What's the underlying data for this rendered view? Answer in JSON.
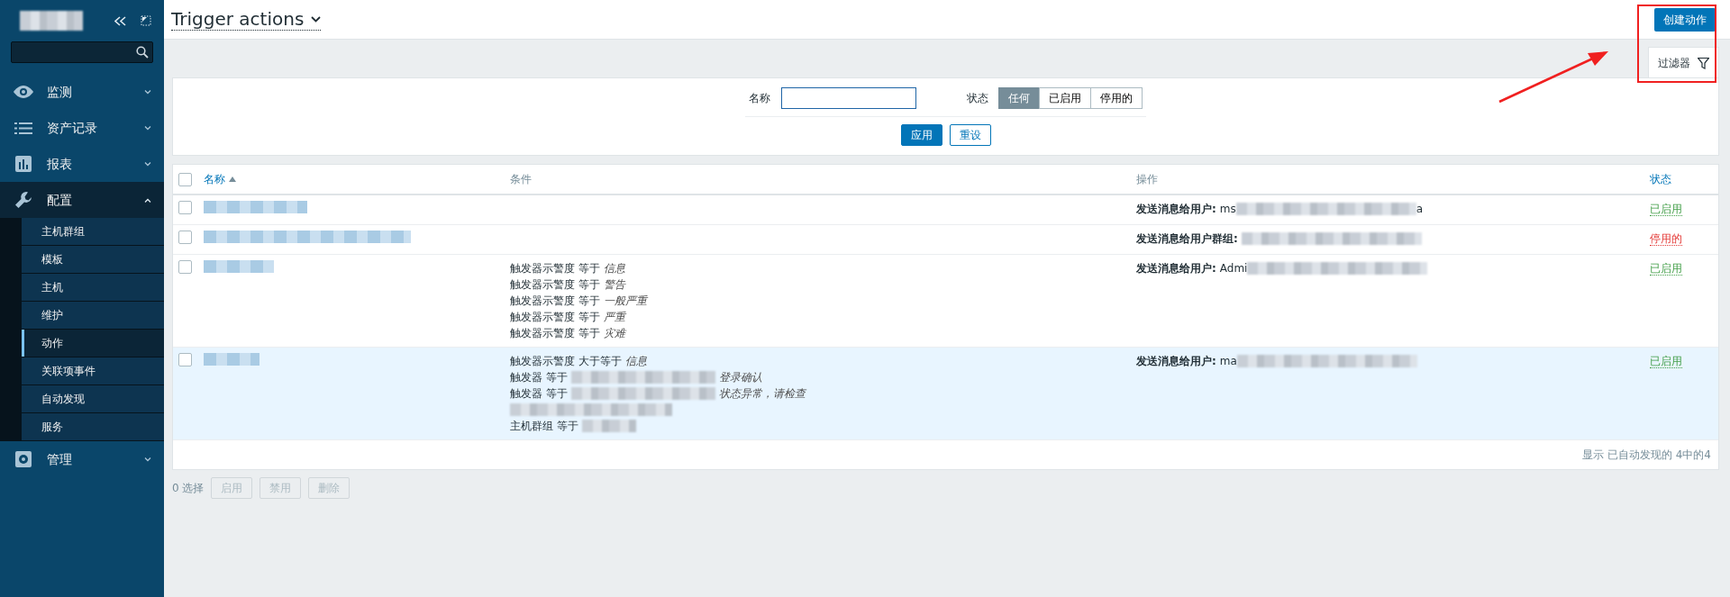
{
  "sidebar": {
    "menu": [
      {
        "label": "监测",
        "expanded": false
      },
      {
        "label": "资产记录",
        "expanded": false
      },
      {
        "label": "报表",
        "expanded": false
      },
      {
        "label": "配置",
        "expanded": true,
        "children": [
          {
            "label": "主机群组",
            "selected": false
          },
          {
            "label": "模板",
            "selected": false
          },
          {
            "label": "主机",
            "selected": false
          },
          {
            "label": "维护",
            "selected": false
          },
          {
            "label": "动作",
            "selected": true
          },
          {
            "label": "关联项事件",
            "selected": false
          },
          {
            "label": "自动发现",
            "selected": false
          },
          {
            "label": "服务",
            "selected": false
          }
        ]
      },
      {
        "label": "管理",
        "expanded": false
      }
    ]
  },
  "header": {
    "title": "Trigger actions",
    "create_button": "创建动作"
  },
  "filter": {
    "tab": "过滤器",
    "name_label": "名称",
    "state_label": "状态",
    "state_options": [
      {
        "label": "任何",
        "selected": true
      },
      {
        "label": "已启用",
        "selected": false
      },
      {
        "label": "停用的",
        "selected": false
      }
    ],
    "apply": "应用",
    "reset": "重设"
  },
  "table": {
    "select_all": {
      "checked": false
    },
    "columns": [
      {
        "label": "名称",
        "sorted": true,
        "kind": "link"
      },
      {
        "label": "条件",
        "sorted": false,
        "kind": "plain"
      },
      {
        "label": "操作",
        "sorted": false,
        "kind": "plain"
      },
      {
        "label": "状态",
        "sorted": false,
        "kind": "link"
      }
    ],
    "rows": [
      {
        "checked": false,
        "highlighted": false,
        "conditions": [],
        "operation": {
          "label": "发送消息给用户:",
          "value": "ms",
          "tail": "a"
        },
        "status": {
          "text": "已启用",
          "kind": "enabled"
        }
      },
      {
        "checked": false,
        "highlighted": false,
        "conditions": [],
        "operation": {
          "label": "发送消息给用户群组:"
        },
        "status": {
          "text": "停用的",
          "kind": "disabled"
        }
      },
      {
        "checked": false,
        "highlighted": false,
        "conditions": [
          {
            "text": "触发器示警度 等于",
            "blurred": false,
            "value": "信息"
          },
          {
            "text": "触发器示警度 等于",
            "blurred": false,
            "value": "警告"
          },
          {
            "text": "触发器示警度 等于",
            "blurred": false,
            "value": "一般严重"
          },
          {
            "text": "触发器示警度 等于",
            "blurred": false,
            "value": "严重"
          },
          {
            "text": "触发器示警度 等于",
            "blurred": false,
            "value": "灾难"
          }
        ],
        "operation": {
          "label": "发送消息给用户:",
          "value": "Admi"
        },
        "status": {
          "text": "已启用",
          "kind": "enabled"
        }
      },
      {
        "checked": false,
        "highlighted": true,
        "conditions": [
          {
            "text": "触发器示警度 大于等于",
            "blurred": false,
            "value": "信息"
          },
          {
            "text": "触发器 等于",
            "blurred": true,
            "value": "登录确认"
          },
          {
            "text": "触发器 等于",
            "blurred": true,
            "value": "状态异常，请检查"
          },
          {
            "blurred": true
          },
          {
            "text": "主机群组 等于",
            "blurred": true
          }
        ],
        "operation": {
          "label": "发送消息给用户:",
          "value": "ma"
        },
        "status": {
          "text": "已启用",
          "kind": "enabled"
        }
      }
    ],
    "footer": "显示 已自动发现的 4中的4"
  },
  "bulk": {
    "selected": "0 选择",
    "buttons": [
      {
        "label": "启用",
        "disabled": true
      },
      {
        "label": "禁用",
        "disabled": true
      },
      {
        "label": "删除",
        "disabled": true
      }
    ]
  }
}
